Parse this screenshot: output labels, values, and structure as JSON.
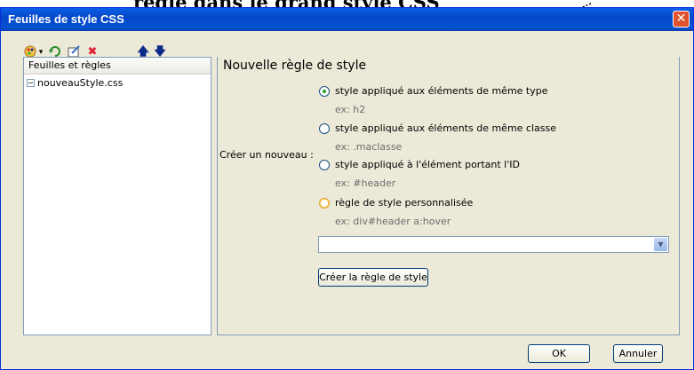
{
  "annotation": {
    "text": "règle dans le grand style CSS"
  },
  "window": {
    "title": "Feuilles de style CSS",
    "close_glyph": "✕"
  },
  "toolbar": {
    "icons": [
      "palette-icon",
      "dropdown-icon",
      "refresh-icon",
      "edit-icon",
      "delete-icon",
      "up-arrow-icon",
      "down-arrow-icon"
    ]
  },
  "left": {
    "header": "Feuilles et règles",
    "item": "nouveauStyle.css",
    "expander": "−"
  },
  "right": {
    "title": "Nouvelle règle de style",
    "create_label": "Créer un nouveau :",
    "options": [
      {
        "label": "style appliqué aux éléments de même type",
        "example": "ex: h2",
        "selected": true
      },
      {
        "label": "style appliqué aux éléments de même classe",
        "example": "ex: .maclasse",
        "selected": false
      },
      {
        "label": "style appliqué à l'élément portant l'ID",
        "example": "ex: #header",
        "selected": false
      },
      {
        "label": "règle de style personnalisée",
        "example": "ex: div#header a:hover",
        "selected": false
      }
    ],
    "combo_value": "",
    "create_button": "Créer la règle de style"
  },
  "footer": {
    "ok": "OK",
    "cancel": "Annuler"
  },
  "colors": {
    "titlebar": "#0553d4",
    "dialog_bg": "#ece9d8",
    "radio_selected": "#21a121"
  }
}
